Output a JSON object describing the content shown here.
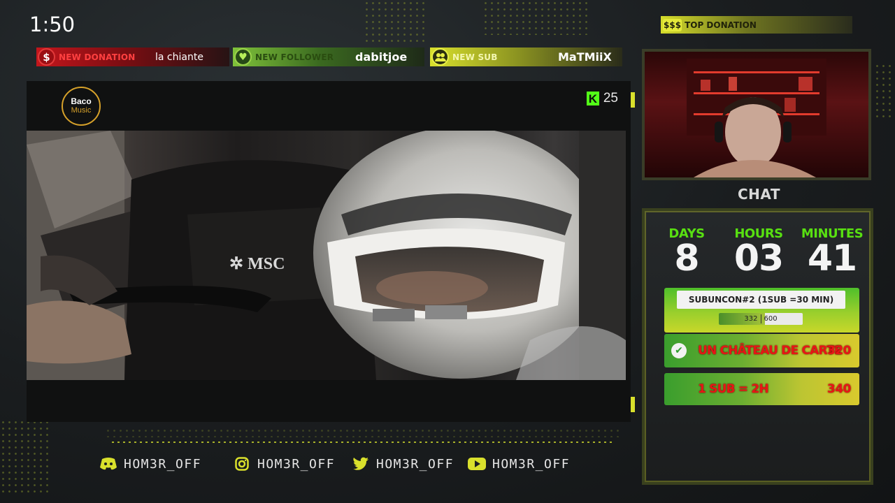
{
  "clock": "1:50",
  "alerts": {
    "donation": {
      "label": "NEW DONATION",
      "value": "la chiante",
      "icon": "dollar-icon"
    },
    "follower": {
      "label": "NEW FOLLOWER",
      "value": "dabitjoe",
      "icon": "heart-icon"
    },
    "sub": {
      "label": "NEW SUB",
      "value": "MaTMiiX",
      "icon": "users-icon"
    }
  },
  "top_donation": {
    "icon_text": "$$$",
    "label": "TOP DONATION"
  },
  "video": {
    "brand_line1": "Baco",
    "brand_line2": "Music",
    "kick_logo": "K",
    "viewer_count": "25",
    "scene_text": "MSC"
  },
  "chat_label": "CHAT",
  "countdown": {
    "days_label": "DAYS",
    "days": "8",
    "hours_label": "HOURS",
    "hours": "03",
    "minutes_label": "MINUTES",
    "minutes": "41"
  },
  "subathon": {
    "title": "SUBUNCON#2 (1SUB =30 MIN)",
    "current": "332",
    "goal": "600",
    "progress": 0.553
  },
  "goals": [
    {
      "name": "UN CHÂTEAU DE CARTE",
      "value": "320",
      "completed": true
    },
    {
      "name": "1 SUB = 2H",
      "value": "340",
      "completed": false
    }
  ],
  "socials": [
    {
      "icon": "discord-icon",
      "handle": "HOM3R_OFF"
    },
    {
      "icon": "instagram-icon",
      "handle": "HOM3R_OFF"
    },
    {
      "icon": "twitter-icon",
      "handle": "HOM3R_OFF"
    },
    {
      "icon": "youtube-icon",
      "handle": "HOM3R_OFF"
    }
  ],
  "colors": {
    "accent": "#d9e02c",
    "donation_red": "#c4161c",
    "follower_green": "#7fc23a",
    "kick_green": "#53fc18",
    "goal_text_red": "#e81515"
  }
}
